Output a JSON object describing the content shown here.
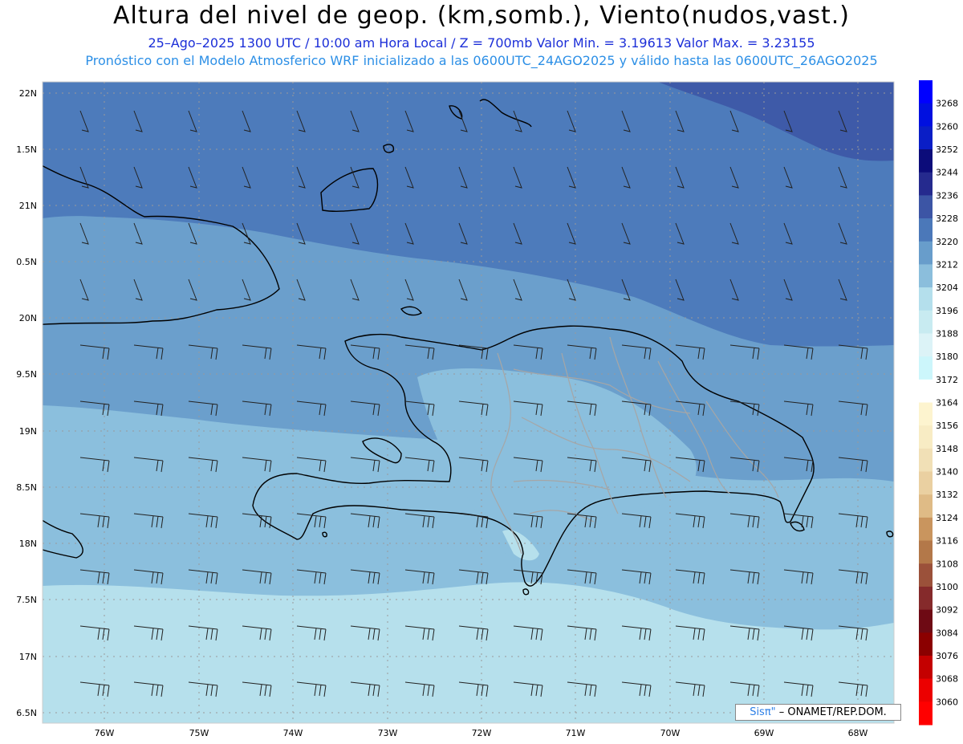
{
  "header": {
    "title": "Altura del nivel de geop. (km,somb.), Viento(nudos,vast.)",
    "subtitle_line1": "25–Ago–2025  1300 UTC / 10:00 am Hora Local / Z = 700mb    Valor Min. = 3.19613  Valor Max. = 3.23155",
    "subtitle_line2": "Pronóstico con el Modelo Atmosferico WRF inicializado a las 0600UTC_24AGO2025 y válido hasta las  0600UTC_26AGO2025"
  },
  "map": {
    "lat_labels": [
      "22N",
      "1.5N",
      "21N",
      "0.5N",
      "20N",
      "9.5N",
      "19N",
      "8.5N",
      "18N",
      "7.5N",
      "17N",
      "6.5N"
    ],
    "lon_labels": [
      "76W",
      "75W",
      "74W",
      "73W",
      "72W",
      "71W",
      "70W",
      "69W",
      "68W"
    ],
    "lat_values": [
      22,
      21.5,
      21,
      20.5,
      20,
      19.5,
      19,
      18.5,
      18,
      17.5,
      17,
      16.5
    ],
    "lon_values": [
      -76,
      -75,
      -74,
      -73,
      -72,
      -71,
      -70,
      -69,
      -68
    ],
    "colors": {
      "band_3228": "#3e5aa8",
      "band_3220": "#4d7bbb",
      "band_3212": "#6b9fcc",
      "band_3204": "#8bbfdd",
      "band_3196": "#b6e0ec",
      "coast": "#000000",
      "provinces": "#a6a6a6",
      "barbs": "#222222"
    }
  },
  "colorbar": {
    "labels": [
      "3268",
      "3260",
      "3252",
      "3244",
      "3236",
      "3228",
      "3220",
      "3212",
      "3204",
      "3196",
      "3188",
      "3180",
      "3172",
      "3164",
      "3156",
      "3148",
      "3140",
      "3132",
      "3124",
      "3116",
      "3108",
      "3100",
      "3092",
      "3084",
      "3076",
      "3068",
      "3060"
    ],
    "colors": [
      "#0000ff",
      "#0010e0",
      "#0a1ec6",
      "#0c0c7a",
      "#252a8e",
      "#3c55a5",
      "#4b78b9",
      "#689dcb",
      "#8bbedc",
      "#b4dfec",
      "#c8ebf1",
      "#dcf3f7",
      "#ccf6fb",
      "#ffffff",
      "#fdf4cf",
      "#f8ecc4",
      "#f1e0b6",
      "#ead0a1",
      "#dfbb86",
      "#c9955e",
      "#b37849",
      "#9b513a",
      "#852a2b",
      "#6e0a14",
      "#8b0000",
      "#c40000",
      "#ec0000",
      "#ff0000"
    ]
  },
  "credit": {
    "brand": "Sisπ\"",
    "text": "– ONAMET/REP.DOM."
  }
}
